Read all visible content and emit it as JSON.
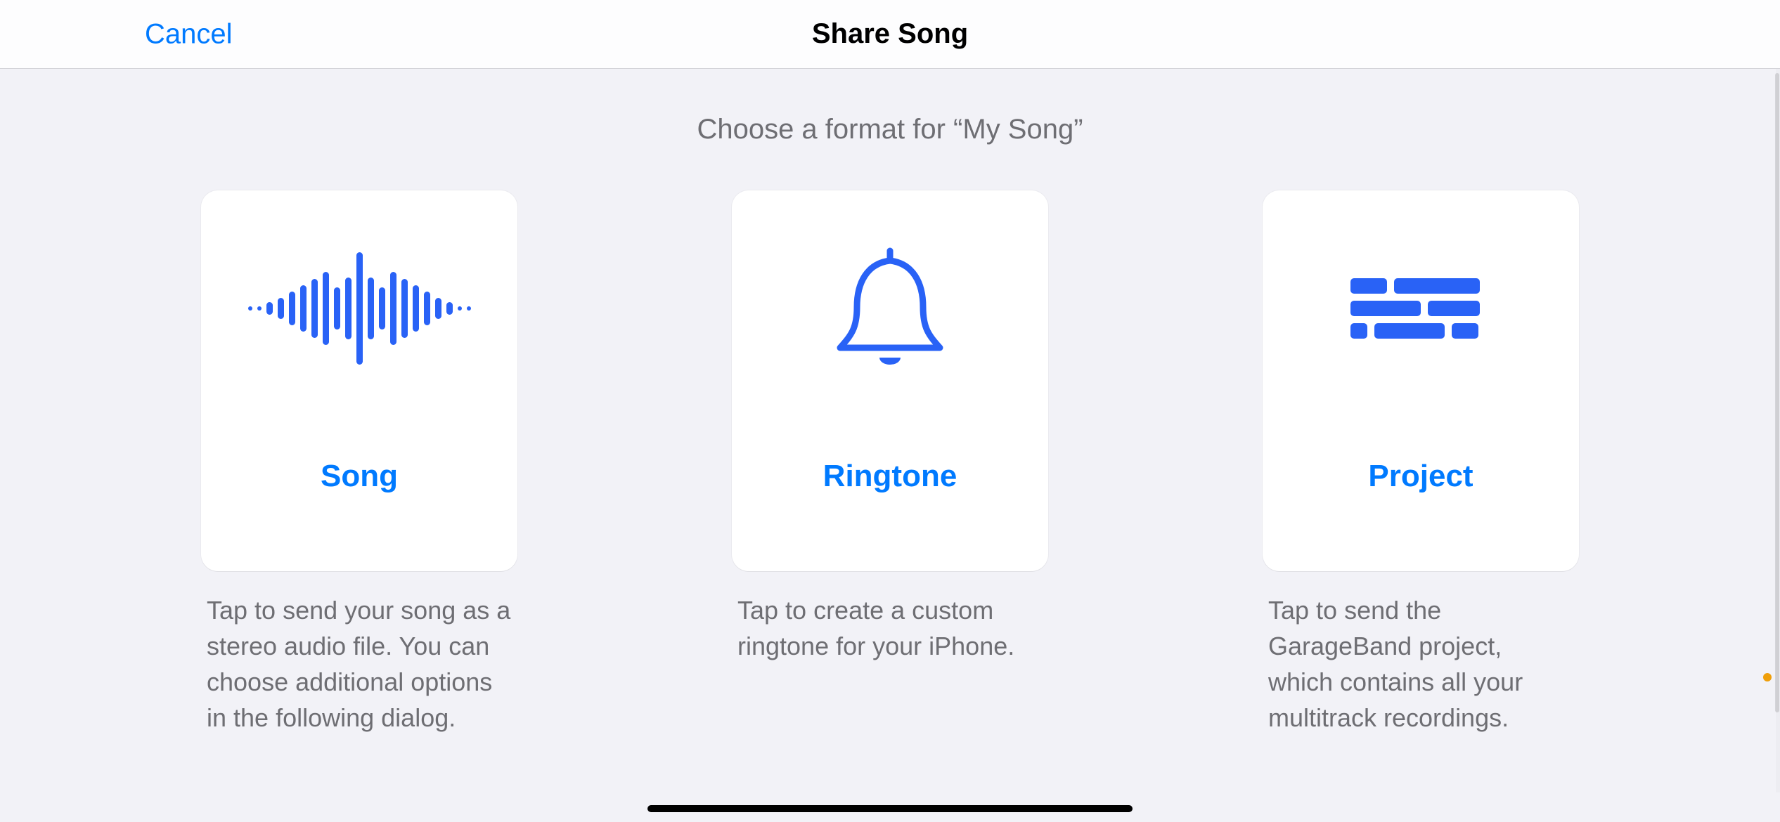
{
  "nav": {
    "cancel": "Cancel",
    "title": "Share Song"
  },
  "subheading": "Choose a format for “My Song”",
  "options": {
    "song": {
      "label": "Song",
      "description": "Tap to send your song as a stereo audio file. You can choose additional options in the following dialog."
    },
    "ringtone": {
      "label": "Ringtone",
      "description": "Tap to create a custom ringtone for your iPhone."
    },
    "project": {
      "label": "Project",
      "description": "Tap to send the GarageBand project, which contains all your multitrack recordings."
    }
  },
  "colors": {
    "accent": "#007aff",
    "icon": "#2962f6",
    "secondary_text": "#6e6e73",
    "bg": "#f2f2f7",
    "card_bg": "#ffffff"
  }
}
